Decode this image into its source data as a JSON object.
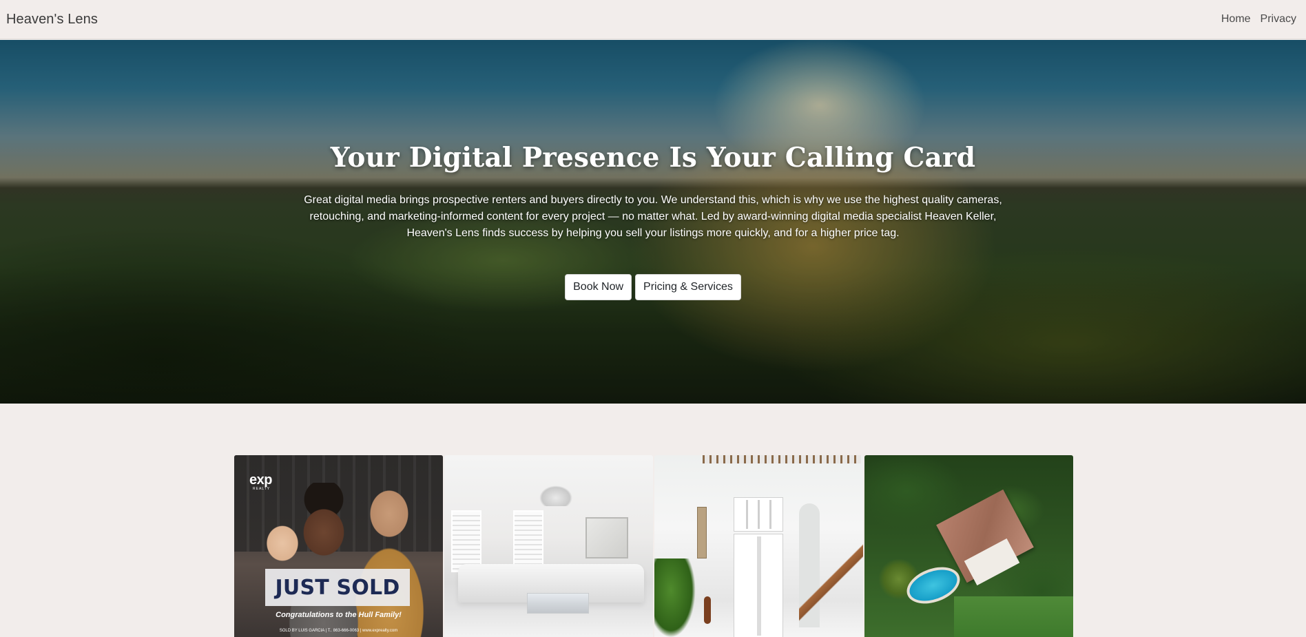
{
  "navbar": {
    "brand": "Heaven's Lens",
    "links": [
      "Home",
      "Privacy"
    ]
  },
  "hero": {
    "title": "Your Digital Presence Is Your Calling Card",
    "text": "Great digital media brings prospective renters and buyers directly to you. We understand this, which is why we use the highest quality cameras, retouching, and marketing-informed content for every project — no matter what. Led by award-winning digital media specialist Heaven Keller, Heaven's Lens finds success by helping you sell your listings more quickly, and for a higher price tag.",
    "buttons": {
      "book": "Book Now",
      "pricing": "Pricing & Services"
    }
  },
  "gallery": {
    "tiles": [
      {
        "subject": "just-sold-card",
        "logo": "exp",
        "logo_sub": "REALTY",
        "banner": "JUST SOLD",
        "congrats": "Congratulations to the Hull Family!",
        "footer": "SOLD BY LUIS GARCIA | T.. 863-666-0063 | www.exprealty.com"
      },
      {
        "subject": "living-room"
      },
      {
        "subject": "foyer"
      },
      {
        "subject": "aerial-estate"
      }
    ]
  },
  "colors": {
    "page_bg": "#f2edeb",
    "button_bg": "#ffffff",
    "sold_banner_text": "#1d2a54"
  }
}
